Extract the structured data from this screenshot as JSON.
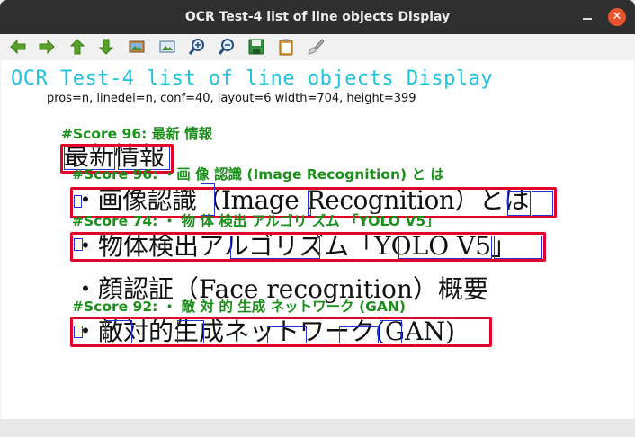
{
  "window": {
    "title": "OCR Test-4 list of line objects Display",
    "close_glyph": "✕"
  },
  "toolbar": {
    "icons": [
      "arrow-left-icon",
      "arrow-right-icon",
      "arrow-up-icon",
      "arrow-down-icon",
      "image-icon",
      "fit-image-icon",
      "zoom-in-icon",
      "zoom-out-icon",
      "save-icon",
      "clipboard-icon",
      "brush-icon"
    ]
  },
  "display": {
    "heading": "OCR Test-4 list of line objects Display",
    "params": "pros=n, linedel=n, conf=40, layout=6  width=704, height=399",
    "lines": [
      {
        "score_label": "#Score 96:  最新 情報",
        "text": "最新情報"
      },
      {
        "score_label": "#Score 96:  ・画 像 認識 (Image Recognition) と は",
        "text": "・画像認識（Image Recognition）とは"
      },
      {
        "score_label": "#Score 74:  ・ 物 体 検出 アルゴリ ズム 「YOLO V5」",
        "text": "・物体検出アルゴリズム「YOLO V5」"
      },
      {
        "text": "・顔認証（Face recognition）概要"
      },
      {
        "score_label": "#Score 92:  ・ 敵 対 的 生成 ネットワーク (GAN)",
        "text": "・敵対的生成ネットワーク(GAN)"
      }
    ]
  },
  "colors": {
    "heading": "#1fc3dc",
    "score": "#1a8f1a",
    "line_box": "#e3002b",
    "word_box": "#2432d6"
  }
}
